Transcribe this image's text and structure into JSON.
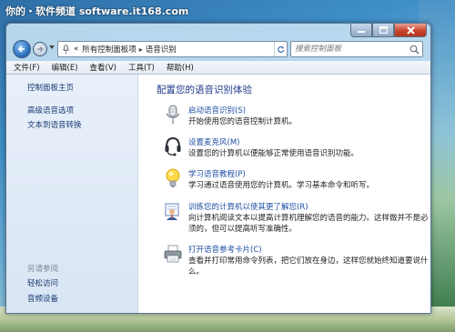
{
  "watermark": "你的・软件频道 software.it168.com",
  "window": {
    "caption_buttons": [
      "minimize",
      "maximize",
      "close"
    ]
  },
  "address_bar": {
    "prefix": "«",
    "crumbs": [
      "所有控制面板项",
      "语音识别"
    ],
    "separator": "▸"
  },
  "search": {
    "placeholder": "搜索控制面板"
  },
  "menu": [
    "文件(F)",
    "编辑(E)",
    "查看(V)",
    "工具(T)",
    "帮助(H)"
  ],
  "sidebar": {
    "home": "控制面板主页",
    "links": [
      "高级语音选项",
      "文本到语音转换"
    ],
    "see_also_heading": "另请参阅",
    "see_also": [
      "轻松访问",
      "音频设备"
    ]
  },
  "main": {
    "title": "配置您的语音识别体验",
    "tasks": [
      {
        "icon": "microphone-icon",
        "link": "启动语音识别(S)",
        "desc": "开始使用您的语音控制计算机。"
      },
      {
        "icon": "headset-icon",
        "link": "设置麦克风(M)",
        "desc": "设置您的计算机以便能够正常使用语音识别功能。"
      },
      {
        "icon": "lightbulb-icon",
        "link": "学习语音教程(P)",
        "desc": "学习通过语音使用您的计算机。学习基本命令和听写。"
      },
      {
        "icon": "user-training-icon",
        "link": "训练您的计算机以使其更了解您(R)",
        "desc": "向计算机阅读文本以提高计算机理解您的语音的能力。这样做并不是必须的，但可以提高听写准确性。"
      },
      {
        "icon": "printer-icon",
        "link": "打开语音参考卡片(C)",
        "desc": "查看并打印常用命令列表，把它们放在身边，这样您就始终知道要说什么。"
      }
    ]
  }
}
